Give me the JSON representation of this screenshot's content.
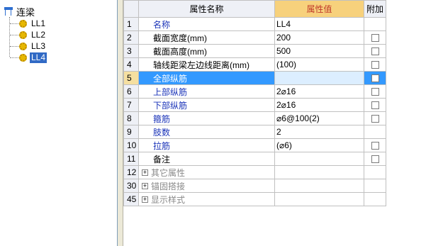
{
  "tree": {
    "root_label": "连梁",
    "items": [
      {
        "label": "LL1",
        "selected": false
      },
      {
        "label": "LL2",
        "selected": false
      },
      {
        "label": "LL3",
        "selected": false
      },
      {
        "label": "LL4",
        "selected": true
      }
    ]
  },
  "grid": {
    "headers": {
      "name": "属性名称",
      "value": "属性值",
      "extra": "附加"
    },
    "rows": [
      {
        "num": "1",
        "name": "名称",
        "value": "LL4",
        "color": "blue",
        "checkbox": false
      },
      {
        "num": "2",
        "name": "截面宽度(mm)",
        "value": "200",
        "color": "black",
        "checkbox": true
      },
      {
        "num": "3",
        "name": "截面高度(mm)",
        "value": "500",
        "color": "black",
        "checkbox": true
      },
      {
        "num": "4",
        "name": "轴线距梁左边线距离(mm)",
        "value": "(100)",
        "color": "black",
        "checkbox": true
      },
      {
        "num": "5",
        "name": "全部纵筋",
        "value": "",
        "color": "blue",
        "checkbox": true,
        "selected": true
      },
      {
        "num": "6",
        "name": "上部纵筋",
        "value": "2⌀16",
        "color": "blue",
        "checkbox": true
      },
      {
        "num": "7",
        "name": "下部纵筋",
        "value": "2⌀16",
        "color": "blue",
        "checkbox": true
      },
      {
        "num": "8",
        "name": "箍筋",
        "value": "⌀6@100(2)",
        "color": "blue",
        "checkbox": true
      },
      {
        "num": "9",
        "name": "肢数",
        "value": "2",
        "color": "blue",
        "checkbox": false
      },
      {
        "num": "10",
        "name": "拉筋",
        "value": "(⌀6)",
        "color": "blue",
        "checkbox": true
      },
      {
        "num": "11",
        "name": "备注",
        "value": "",
        "color": "black",
        "checkbox": true
      }
    ],
    "groups": [
      {
        "num": "12",
        "label": "其它属性"
      },
      {
        "num": "30",
        "label": "锚固搭接"
      },
      {
        "num": "45",
        "label": "显示样式"
      }
    ]
  }
}
